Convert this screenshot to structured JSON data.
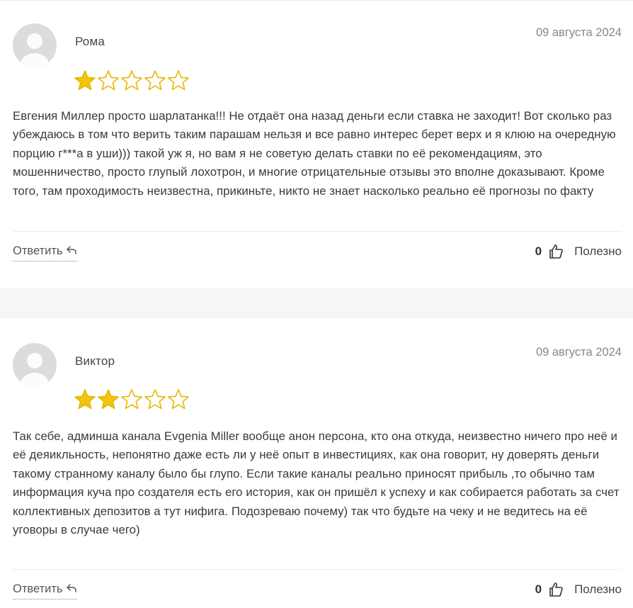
{
  "reviews": [
    {
      "author": "Рома",
      "date": "09 августа 2024",
      "rating": 1,
      "max_rating": 5,
      "text": "Евгения Миллер просто шарлатанка!!! Не отдаёт она назад деньги если ставка не заходит! Вот сколько раз убеждаюсь в том что верить таким парашам нельзя и все равно интерес берет верх и я клюю на очередную порцию г***а в уши))) такой уж я, но вам я не советую делать ставки по её рекомендациям, это мошенничество, просто глупый лохотрон, и многие отрицательные отзывы это вполне доказывают. Кроме того, там проходимость неизвестна, прикиньте, никто не знает насколько реально её прогнозы по факту",
      "reply_label": "Ответить",
      "likes": "0",
      "helpful_label": "Полезно"
    },
    {
      "author": "Виктор",
      "date": "09 августа 2024",
      "rating": 2,
      "max_rating": 5,
      "text": "Так себе, админша канала Evgenia Miller вообще анон персона, кто она откуда, неизвестно ничего про неё и её деяикльность, непонятно даже есть ли у неё опыт в инвестициях, как она говорит, ну доверять деньги такому странному каналу было бы глупо. Если такие каналы реально приносят прибыль ,то обычно там информация куча про создателя есть его история, как он пришёл к успеху и как собирается работать за счет коллективных депозитов а тут нифига. Подозреваю почему) так что будьте на чеку и не ведитесь на её уговоры в случае чего)",
      "reply_label": "Ответить",
      "likes": "0",
      "helpful_label": "Полезно"
    }
  ],
  "colors": {
    "star_fill": "#f1c40f",
    "star_outline": "#e6b800",
    "avatar_bg": "#dcdcdc"
  },
  "icons": {
    "reply": "reply-arrow-icon",
    "helpful": "thumbs-up-icon",
    "star": "star-icon",
    "avatar": "user-placeholder-icon"
  }
}
